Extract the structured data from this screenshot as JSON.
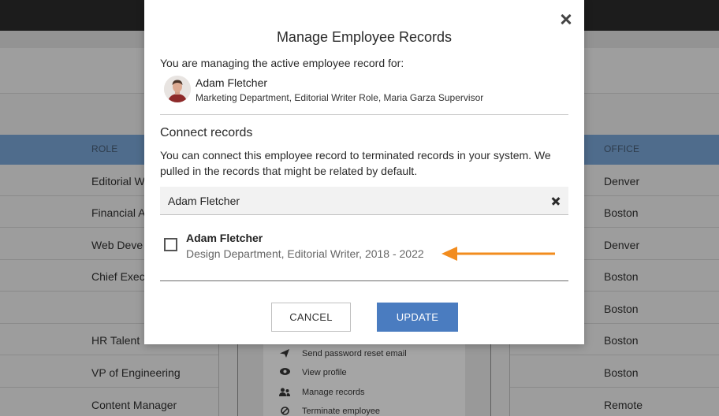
{
  "background": {
    "table": {
      "headers": {
        "role": "ROLE",
        "office": "OFFICE"
      },
      "rows": [
        {
          "role": "Editorial W",
          "office": "Denver"
        },
        {
          "role": "Financial A",
          "office": "Boston"
        },
        {
          "role": "Web Deve",
          "office": "Denver"
        },
        {
          "role": "Chief Exec",
          "office": "Boston"
        },
        {
          "role": "",
          "office": "Boston"
        },
        {
          "role": "HR Talent",
          "office": "Boston"
        },
        {
          "role": "VP of Engineering",
          "office": "Boston"
        },
        {
          "role": "Content Manager",
          "office": "Remote"
        }
      ]
    },
    "row_menu": {
      "items": [
        {
          "icon": "send-icon",
          "label": "Send password reset email"
        },
        {
          "icon": "eye-icon",
          "label": "View profile"
        },
        {
          "icon": "users-icon",
          "label": "Manage records"
        },
        {
          "icon": "ban-icon",
          "label": "Terminate employee"
        }
      ]
    }
  },
  "modal": {
    "title": "Manage Employee Records",
    "intro": "You are managing the active employee record for:",
    "employee": {
      "name": "Adam Fletcher",
      "description": "Marketing Department, Editorial Writer Role, Maria Garza Supervisor"
    },
    "connect": {
      "title": "Connect records",
      "description": "You can connect this employee record to terminated records in your system. We pulled in the records that might be related by default."
    },
    "search": {
      "value": "Adam Fletcher",
      "placeholder": ""
    },
    "results": [
      {
        "name": "Adam Fletcher",
        "description": "Design Department, Editorial Writer, 2018 - 2022",
        "checked": false
      }
    ],
    "buttons": {
      "cancel": "CANCEL",
      "update": "UPDATE"
    }
  },
  "colors": {
    "accent": "#4a7cc0",
    "annotation_arrow": "#f28c1e",
    "table_header": "#4f6c8c"
  }
}
